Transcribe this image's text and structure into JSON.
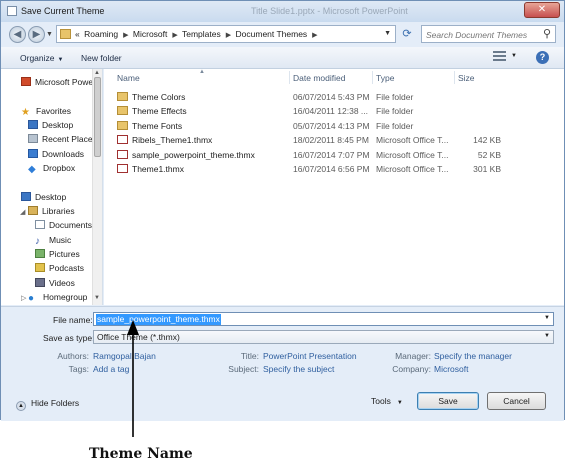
{
  "window": {
    "title": "Save Current Theme",
    "background_title": "Title Slide1.pptx - Microsoft PowerPoint",
    "close_label": "✕"
  },
  "address": {
    "crumbs": [
      "«",
      "Roaming",
      "Microsoft",
      "Templates",
      "Document Themes"
    ],
    "search_placeholder": "Search Document Themes"
  },
  "toolbar": {
    "organize_label": "Organize",
    "new_folder_label": "New folder",
    "help_label": "?"
  },
  "nav": {
    "items": [
      {
        "label": "Microsoft Powe",
        "icon": "powerpoint-icon"
      },
      {
        "label": "Favorites",
        "icon": "favorites-star-icon"
      },
      {
        "label": "Desktop",
        "icon": "desktop-icon"
      },
      {
        "label": "Recent Places",
        "icon": "recent-places-icon"
      },
      {
        "label": "Downloads",
        "icon": "downloads-icon"
      },
      {
        "label": "Dropbox",
        "icon": "dropbox-icon"
      },
      {
        "label": "Desktop",
        "icon": "desktop-icon"
      },
      {
        "label": "Libraries",
        "icon": "libraries-icon"
      },
      {
        "label": "Documents",
        "icon": "documents-icon"
      },
      {
        "label": "Music",
        "icon": "music-icon"
      },
      {
        "label": "Pictures",
        "icon": "pictures-icon"
      },
      {
        "label": "Podcasts",
        "icon": "podcasts-icon"
      },
      {
        "label": "Videos",
        "icon": "videos-icon"
      },
      {
        "label": "Homegroup",
        "icon": "homegroup-icon"
      }
    ]
  },
  "files": {
    "columns": [
      "Name",
      "Date modified",
      "Type",
      "Size"
    ],
    "rows": [
      {
        "name": "Theme Colors",
        "date": "06/07/2014 5:43 PM",
        "type": "File folder",
        "size": "",
        "kind": "folder"
      },
      {
        "name": "Theme Effects",
        "date": "16/04/2011 12:38 ...",
        "type": "File folder",
        "size": "",
        "kind": "folder"
      },
      {
        "name": "Theme Fonts",
        "date": "05/07/2014 4:13 PM",
        "type": "File folder",
        "size": "",
        "kind": "folder"
      },
      {
        "name": "Ribels_Theme1.thmx",
        "date": "18/02/2011 8:45 PM",
        "type": "Microsoft Office T...",
        "size": "142 KB",
        "kind": "thmx"
      },
      {
        "name": "sample_powerpoint_theme.thmx",
        "date": "16/07/2014 7:07 PM",
        "type": "Microsoft Office T...",
        "size": "52 KB",
        "kind": "thmx"
      },
      {
        "name": "Theme1.thmx",
        "date": "16/07/2014 6:56 PM",
        "type": "Microsoft Office T...",
        "size": "301 KB",
        "kind": "thmx"
      }
    ]
  },
  "save": {
    "file_name_label": "File name:",
    "file_name_value": "sample_powerpoint_theme.thmx",
    "save_as_type_label": "Save as type:",
    "save_as_type_value": "Office Theme (*.thmx)"
  },
  "meta": {
    "authors_label": "Authors:",
    "authors_value": "Ramgopal Bajan",
    "tags_label": "Tags:",
    "tags_value": "Add a tag",
    "title_label": "Title:",
    "title_value": "PowerPoint Presentation",
    "subject_label": "Subject:",
    "subject_value": "Specify the subject",
    "manager_label": "Manager:",
    "manager_value": "Specify the manager",
    "company_label": "Company:",
    "company_value": "Microsoft"
  },
  "footer": {
    "hide_folders_label": "Hide Folders",
    "tools_label": "Tools",
    "save_label": "Save",
    "cancel_label": "Cancel"
  },
  "annotation": {
    "label": "Theme Name"
  },
  "colors": {
    "accent": "#3399ff",
    "link": "#2f5f9f",
    "frame": "#e4edf8"
  }
}
